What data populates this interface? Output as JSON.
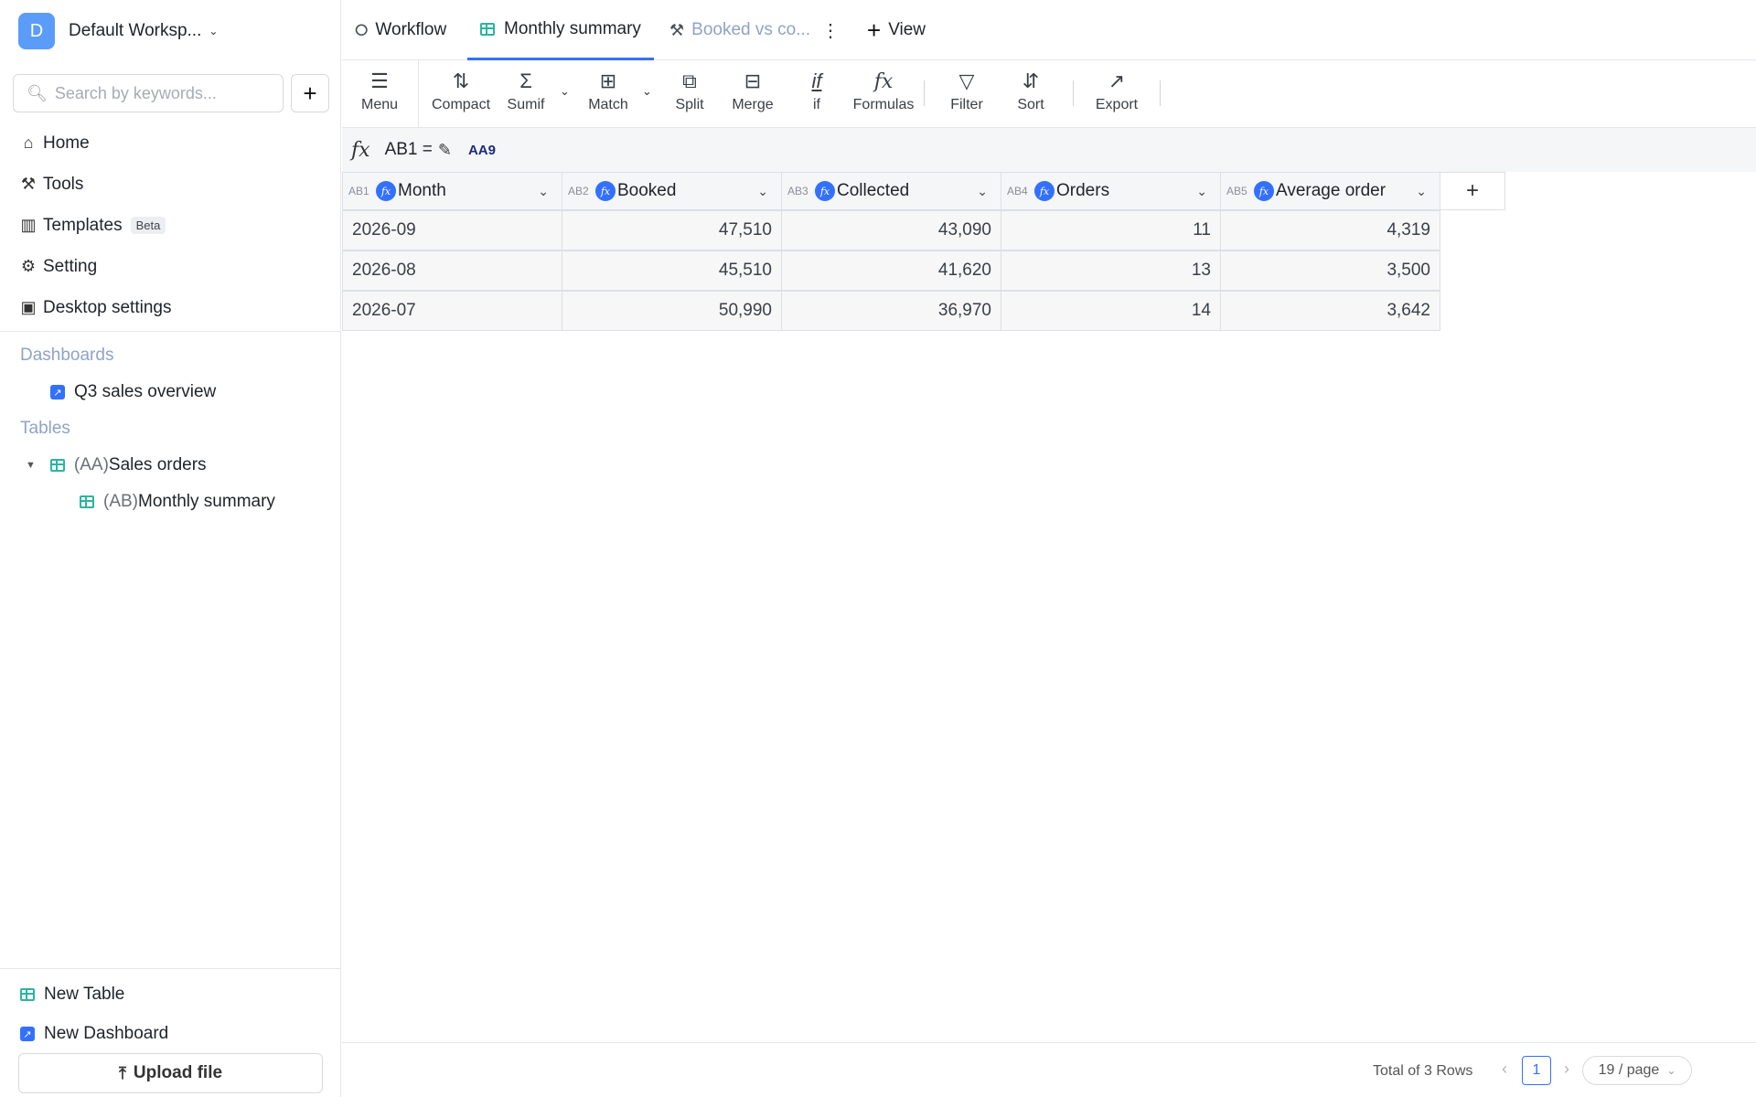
{
  "workspace": {
    "avatar_letter": "D",
    "name": "Default Worksp..."
  },
  "search": {
    "placeholder": "Search by keywords..."
  },
  "nav": {
    "home": "Home",
    "tools": "Tools",
    "templates": "Templates",
    "templates_badge": "Beta",
    "setting": "Setting",
    "desktop_settings": "Desktop settings"
  },
  "dashboards": {
    "title": "Dashboards",
    "items": [
      {
        "label": "Q3 sales overview"
      }
    ]
  },
  "tables": {
    "title": "Tables",
    "items": [
      {
        "prefix": "(AA)",
        "label": "Sales orders"
      },
      {
        "prefix": "(AB)",
        "label": "Monthly summary"
      }
    ]
  },
  "sidebar_footer": {
    "new_table": "New Table",
    "new_dashboard": "New Dashboard",
    "upload": "Upload file"
  },
  "tabs": [
    {
      "label": "Workflow",
      "icon": "workflow-icon"
    },
    {
      "label": "Monthly summary",
      "icon": "table-icon",
      "active": true
    },
    {
      "label": "Booked vs co...",
      "icon": "chart-icon"
    }
  ],
  "view_button": "View",
  "toolbar": {
    "menu": "Menu",
    "compact": "Compact",
    "sumif": "Sumif",
    "match": "Match",
    "split": "Split",
    "merge": "Merge",
    "if": "if",
    "formulas": "Formulas",
    "filter": "Filter",
    "sort": "Sort",
    "export": "Export"
  },
  "formula_bar": {
    "cell": "AB1 =",
    "ref": "AA9"
  },
  "columns": [
    {
      "code": "AB1",
      "name": "Month"
    },
    {
      "code": "AB2",
      "name": "Booked"
    },
    {
      "code": "AB3",
      "name": "Collected"
    },
    {
      "code": "AB4",
      "name": "Orders"
    },
    {
      "code": "AB5",
      "name": "Average order"
    }
  ],
  "rows": [
    [
      "2026-09",
      "47,510",
      "43,090",
      "11",
      "4,319"
    ],
    [
      "2026-08",
      "45,510",
      "41,620",
      "13",
      "3,500"
    ],
    [
      "2026-07",
      "50,990",
      "36,970",
      "14",
      "3,642"
    ]
  ],
  "footer": {
    "total": "Total of 3 Rows",
    "page": "1",
    "page_size": "19 / page"
  },
  "colors": {
    "accent": "#3370ff",
    "avatar": "#5b9cf8",
    "section_title": "#8fa3c8",
    "table_icon": "#2bb5a0"
  }
}
